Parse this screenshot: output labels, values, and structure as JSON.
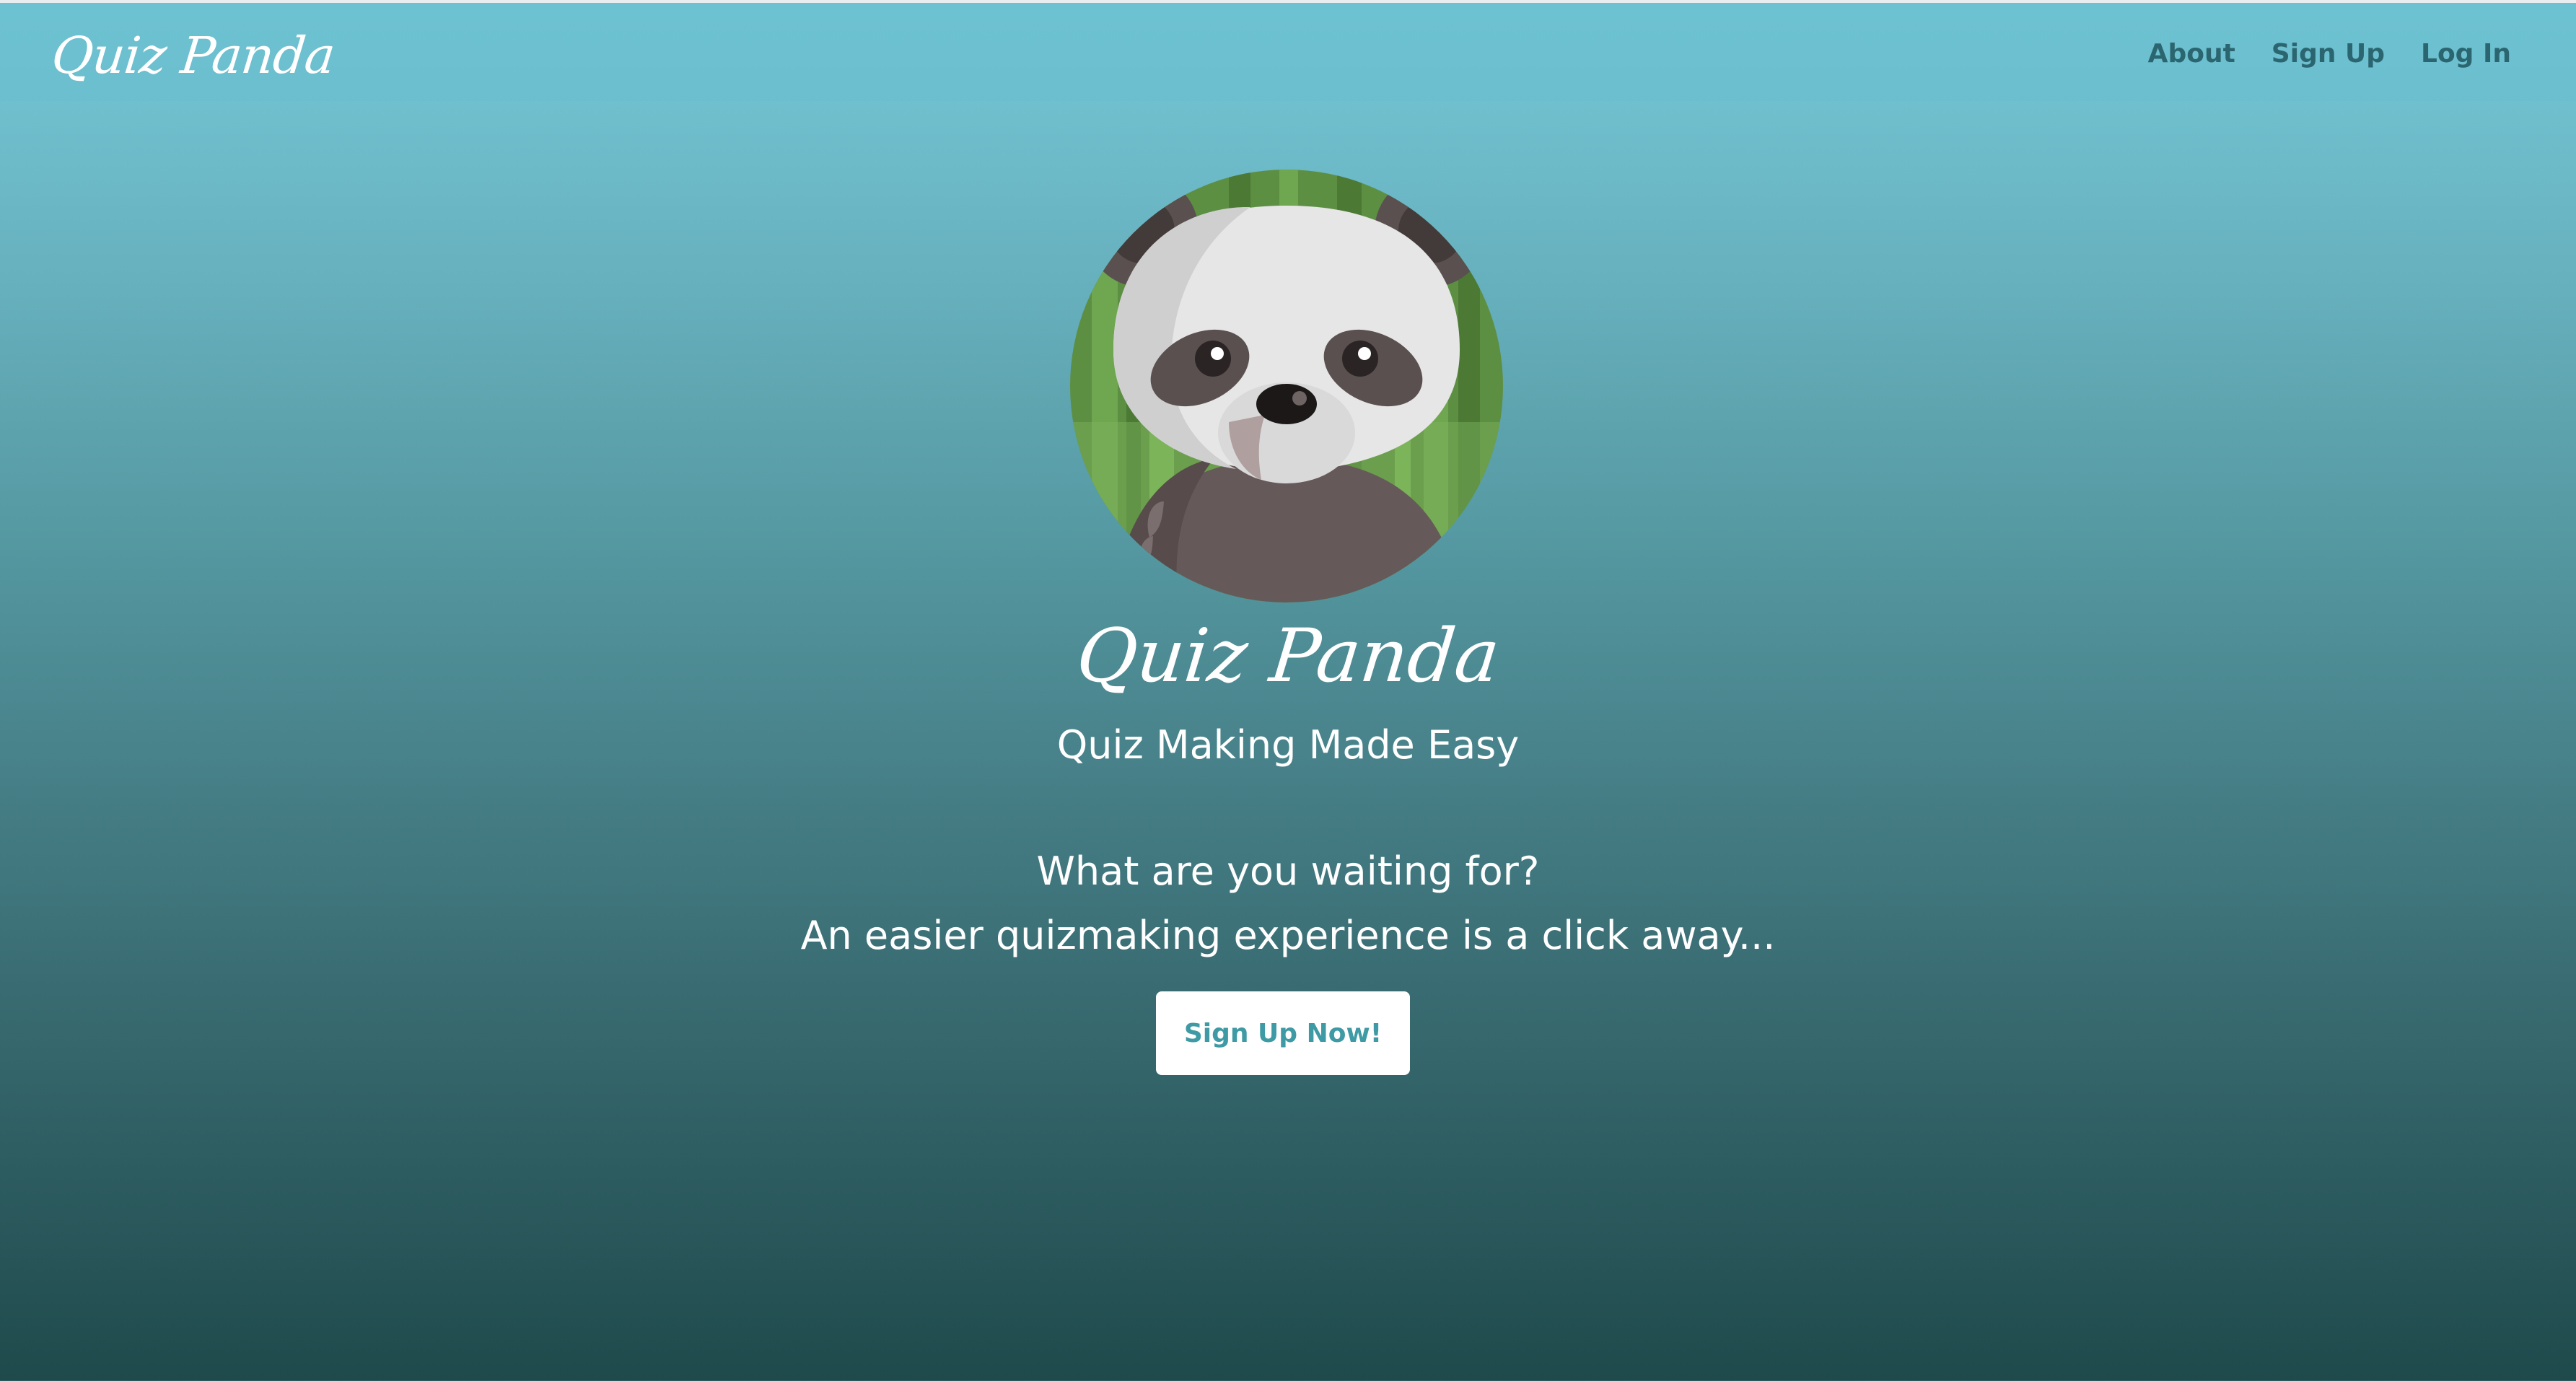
{
  "navbar": {
    "brand": "Quiz Panda",
    "links": [
      "About",
      "Sign Up",
      "Log In"
    ]
  },
  "hero": {
    "avatar": "panda-avatar",
    "title": "Quiz Panda",
    "subtitle": "Quiz Making Made Easy",
    "question": "What are you waiting for?",
    "tagline": "An easier quizmaking experience is a click away...",
    "cta_label": "Sign Up Now!"
  },
  "colors": {
    "gradient_top": "#74c8d7",
    "gradient_bottom": "#1f4a4c",
    "nav_text": "#2b6670",
    "button_text": "#3e9aa4",
    "bamboo_green": "#5d8f43"
  }
}
